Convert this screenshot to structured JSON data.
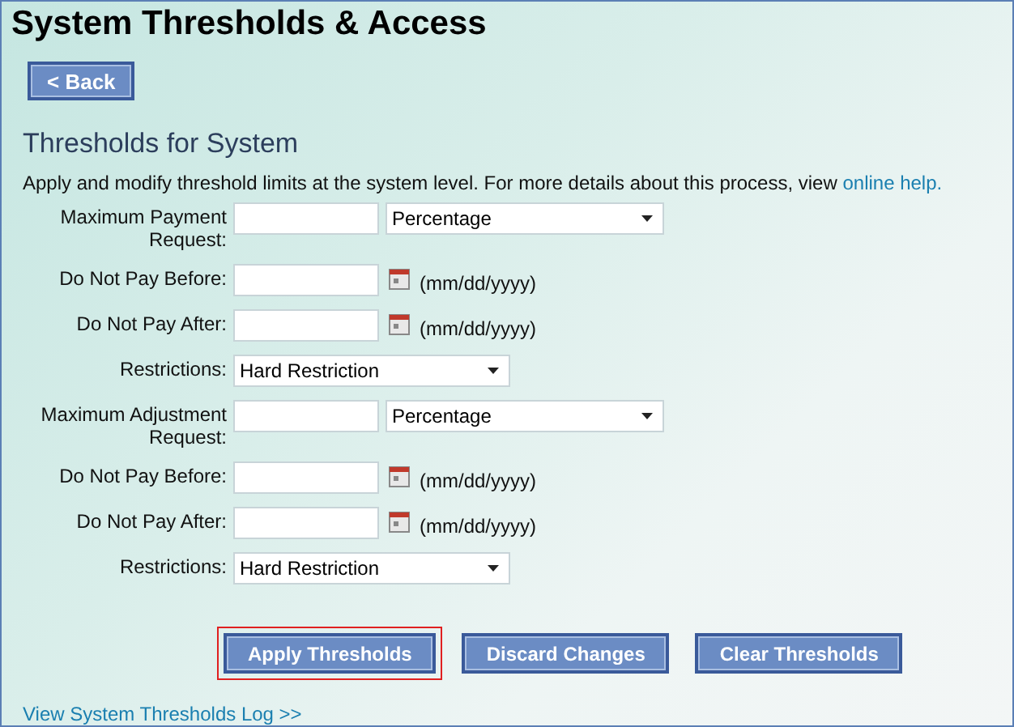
{
  "title": "System Thresholds & Access",
  "back_button": "< Back",
  "section_title": "Thresholds for System",
  "description": {
    "text": "Apply and modify threshold limits at the system level. For more details about this process, view ",
    "link": "online help."
  },
  "rows": [
    {
      "kind": "amount",
      "label": "Maximum Payment Request:",
      "select": "Percentage"
    },
    {
      "kind": "date",
      "label": "Do Not Pay Before:",
      "hint": "(mm/dd/yyyy)"
    },
    {
      "kind": "date",
      "label": "Do Not Pay After:",
      "hint": "(mm/dd/yyyy)"
    },
    {
      "kind": "select",
      "label": "Restrictions:",
      "select": "Hard Restriction"
    },
    {
      "kind": "amount",
      "label": "Maximum Adjustment Request:",
      "select": "Percentage"
    },
    {
      "kind": "date",
      "label": "Do Not Pay Before:",
      "hint": "(mm/dd/yyyy)"
    },
    {
      "kind": "date",
      "label": "Do Not Pay After:",
      "hint": "(mm/dd/yyyy)"
    },
    {
      "kind": "select",
      "label": "Restrictions:",
      "select": "Hard Restriction"
    }
  ],
  "buttons": [
    {
      "label": "Apply Thresholds",
      "highlighted": true
    },
    {
      "label": "Discard Changes",
      "highlighted": false
    },
    {
      "label": "Clear Thresholds",
      "highlighted": false
    }
  ],
  "log_link": "View System Thresholds Log >>"
}
